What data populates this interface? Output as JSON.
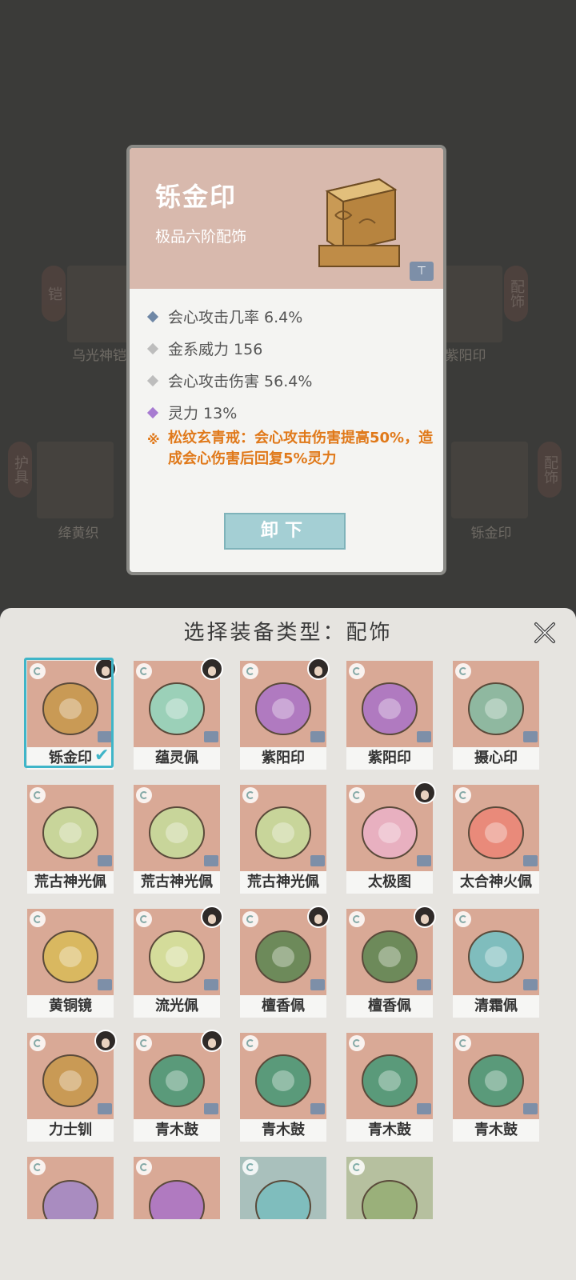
{
  "background": {
    "labels": [
      "乌光神铠",
      "紫阳印",
      "绛黄织",
      "铄金印"
    ],
    "tags": [
      "铠",
      "配饰",
      "护具",
      "配饰"
    ]
  },
  "detail": {
    "name": "铄金印",
    "grade": "极品六阶配饰",
    "stats": [
      {
        "text": "会心攻击几率 6.4%",
        "color": "#6f87a6"
      },
      {
        "text": "金系威力 156",
        "color": "#bdbdbd"
      },
      {
        "text": "会心攻击伤害 56.4%",
        "color": "#bdbdbd"
      },
      {
        "text": "灵力 13%",
        "color": "#a77bd1"
      }
    ],
    "special": "松纹玄青戒：会心攻击伤害提高50%，造成会心伤害后回复5%灵力",
    "button_label": "卸下"
  },
  "sheet": {
    "title": "选择装备类型：配饰",
    "items": [
      {
        "name": "铄金印",
        "selected": true
      },
      {
        "name": "蕴灵佩"
      },
      {
        "name": "紫阳印"
      },
      {
        "name": "紫阳印"
      },
      {
        "name": "摄心印"
      },
      {
        "name": "荒古神光佩"
      },
      {
        "name": "荒古神光佩"
      },
      {
        "name": "荒古神光佩"
      },
      {
        "name": "太极图"
      },
      {
        "name": "太合神火佩"
      },
      {
        "name": "黄铜镜"
      },
      {
        "name": "流光佩"
      },
      {
        "name": "檀香佩"
      },
      {
        "name": "檀香佩"
      },
      {
        "name": "清霜佩"
      },
      {
        "name": "力士钏"
      },
      {
        "name": "青木鼓"
      },
      {
        "name": "青木鼓"
      },
      {
        "name": "青木鼓"
      },
      {
        "name": "青木鼓"
      }
    ]
  }
}
